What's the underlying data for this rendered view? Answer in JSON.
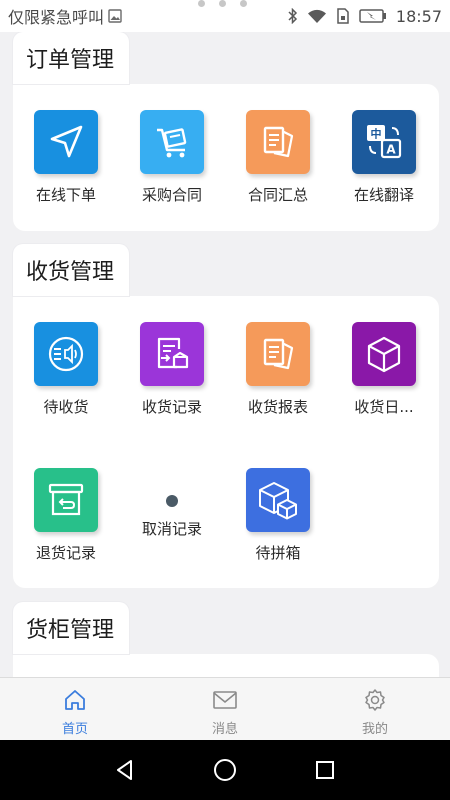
{
  "status_bar": {
    "carrier": "仅限紧急呼叫",
    "time": "18:57",
    "icons": [
      "image-icon",
      "bluetooth-icon",
      "wifi-icon",
      "sim-icon",
      "battery-icon"
    ]
  },
  "colors": {
    "accent": "#3b7ddd",
    "blue": "#1890e0",
    "light_blue": "#37aef2",
    "orange": "#f59a5a",
    "navy": "#1c5a9c",
    "purple": "#9b35d9",
    "violet": "#8a18a8",
    "green": "#28c08a",
    "indigo": "#3d6fe0"
  },
  "sections": {
    "order": {
      "title": "订单管理",
      "items": [
        {
          "label": "在线下单",
          "icon": "navigation-arrow-icon"
        },
        {
          "label": "采购合同",
          "icon": "cart-icon"
        },
        {
          "label": "合同汇总",
          "icon": "documents-icon"
        },
        {
          "label": "在线翻译",
          "icon": "translate-icon"
        }
      ]
    },
    "receiving": {
      "title": "收货管理",
      "items": [
        {
          "label": "待收货",
          "icon": "broadcast-icon"
        },
        {
          "label": "收货记录",
          "icon": "receive-record-icon"
        },
        {
          "label": "收货报表",
          "icon": "documents-icon"
        },
        {
          "label": "收货日...",
          "icon": "box-icon"
        },
        {
          "label": "退货记录",
          "icon": "return-box-icon"
        },
        {
          "label": "取消记录",
          "icon": "dot-icon"
        },
        {
          "label": "待拼箱",
          "icon": "boxes-icon"
        }
      ]
    },
    "container": {
      "title": "货柜管理"
    }
  },
  "bottom_nav": [
    {
      "label": "首页",
      "icon": "home-icon",
      "active": true
    },
    {
      "label": "消息",
      "icon": "mail-icon",
      "active": false
    },
    {
      "label": "我的",
      "icon": "gear-icon",
      "active": false
    }
  ]
}
